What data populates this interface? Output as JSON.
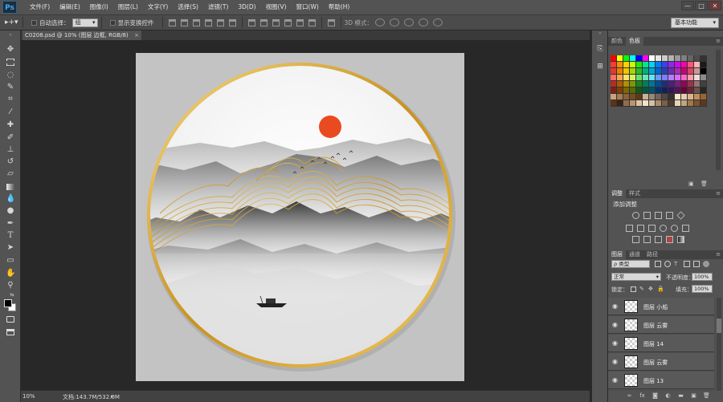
{
  "app": {
    "logo": "Ps"
  },
  "menus": [
    "文件(F)",
    "编辑(E)",
    "图像(I)",
    "图层(L)",
    "文字(Y)",
    "选择(S)",
    "滤镜(T)",
    "3D(D)",
    "视图(V)",
    "窗口(W)",
    "帮助(H)"
  ],
  "window_controls": [
    "—",
    "□",
    "✕"
  ],
  "options": {
    "auto_select_label": "自动选择：",
    "auto_select_value": "组",
    "show_transform_label": "显示变换控件",
    "mode3d_label": "3D 模式：",
    "workspace": "基本功能"
  },
  "document": {
    "tab_label": "C0208.psd @ 10% (图层 边框, RGB/8)",
    "close": "×"
  },
  "status": {
    "zoom": "10%",
    "doc_info": "文档:143.7M/532.0M"
  },
  "panels": {
    "color_tabs": [
      "颜色",
      "色板"
    ],
    "adjust_tabs": [
      "调整",
      "样式"
    ],
    "adjust_title": "添加调整",
    "layers_tabs": [
      "图层",
      "通道",
      "路径"
    ],
    "kind_filter": "ρ 类型",
    "blend_mode": "正常",
    "opacity_label": "不透明度：",
    "opacity_value": "100%",
    "lock_label": "锁定：",
    "fill_label": "填充：",
    "fill_value": "100%",
    "layers": [
      "图层 小船",
      "图层 云雾",
      "图层 14",
      "图层 云雾",
      "图层 13"
    ]
  },
  "swatch_colors": {
    "rows": [
      [
        "#ff0000",
        "#ffff00",
        "#00ff00",
        "#00ffff",
        "#0000ff",
        "#ff00ff",
        "#ffffff",
        "#e6e6e6",
        "#cccccc",
        "#b3b3b3",
        "#999999",
        "#808080",
        "#666666",
        "#4d4d4d",
        "#333333"
      ],
      [
        "#ff3b30",
        "#ff8c00",
        "#ffd000",
        "#c6ff00",
        "#26e600",
        "#00e68a",
        "#00d4ff",
        "#007bff",
        "#3d3dff",
        "#8a2be2",
        "#d400ff",
        "#ff00a8",
        "#ff5577",
        "#ffb3b3",
        "#1a1a1a"
      ],
      [
        "#e03c31",
        "#f07c00",
        "#f2c500",
        "#a8d600",
        "#2fb830",
        "#00b377",
        "#00a6d6",
        "#0066cc",
        "#2d3fb3",
        "#6a2db3",
        "#a52db3",
        "#cc0077",
        "#d94466",
        "#cc9999",
        "#000000"
      ],
      [
        "#ff6f61",
        "#ffa64d",
        "#ffe066",
        "#d4f266",
        "#66e066",
        "#66e6b3",
        "#66e0ff",
        "#6699ff",
        "#7d7dff",
        "#b37dff",
        "#e066ff",
        "#ff66cc",
        "#ff99aa",
        "#f2d9d9",
        "#8c8c8c"
      ],
      [
        "#b32d24",
        "#b35900",
        "#b38f00",
        "#7a9900",
        "#1f8020",
        "#008055",
        "#007599",
        "#004c99",
        "#1f2d80",
        "#4b1f80",
        "#741f80",
        "#990057",
        "#99334d",
        "#997373",
        "#404040"
      ],
      [
        "#801f1a",
        "#804000",
        "#806600",
        "#566b00",
        "#145714",
        "#00573a",
        "#00516b",
        "#00336b",
        "#14205a",
        "#35155a",
        "#52155a",
        "#6b003d",
        "#6b2436",
        "#6b5050",
        "#262626"
      ],
      [
        "#c8a27a",
        "#a67c52",
        "#8c6239",
        "#754c24",
        "#603813",
        "#c7b299",
        "#998675",
        "#736357",
        "#534741",
        "#362f2d",
        "#f5e6cc",
        "#e6ccb3",
        "#d9b38c",
        "#bf8f60",
        "#996633"
      ],
      [
        "#5c3317",
        "#3d2210",
        "#8f6d4a",
        "#b89470",
        "#dec3a1",
        "#f2e2c9",
        "#d6bfa3",
        "#ab8c6e",
        "#7a6049",
        "#4f3c2c",
        "#e8d4b8",
        "#c4a47c",
        "#a0784d",
        "#7c5430",
        "#5a3a1e"
      ]
    ]
  }
}
